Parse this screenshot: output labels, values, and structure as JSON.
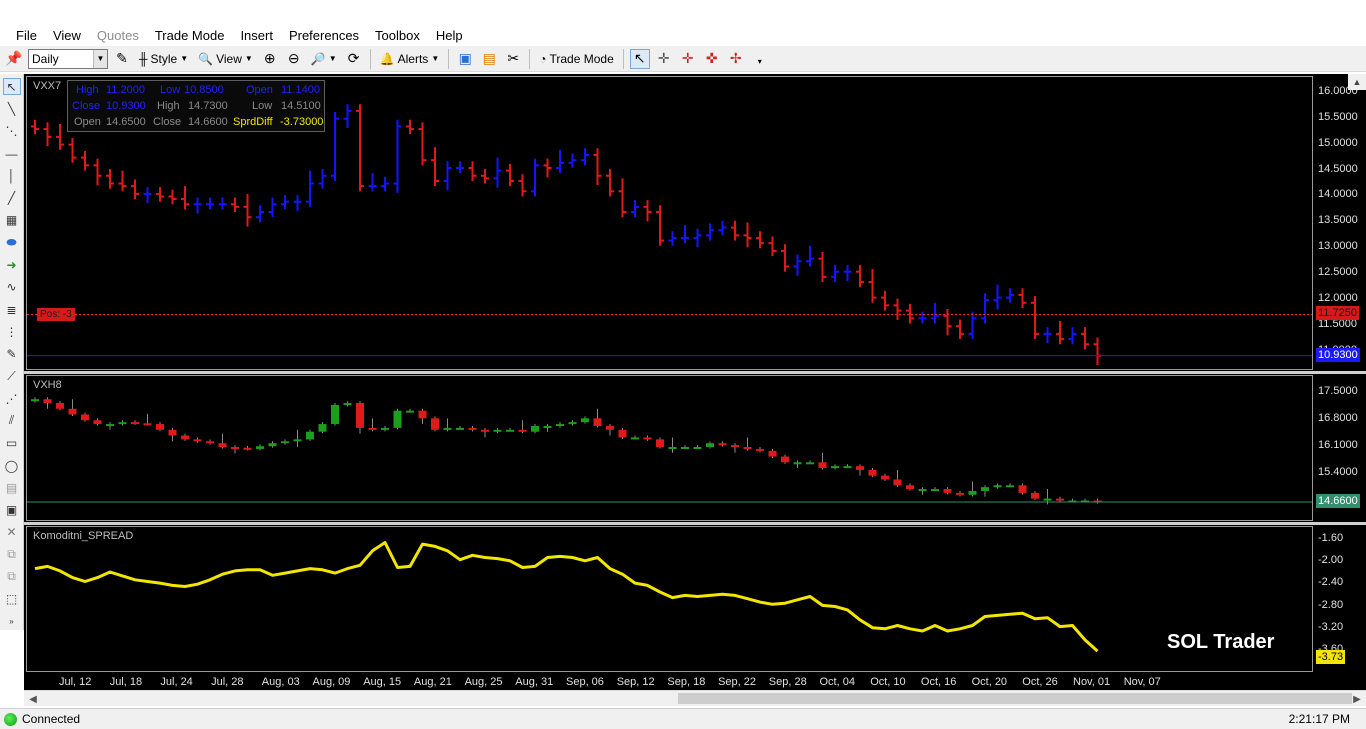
{
  "menu": [
    "File",
    "View",
    "Quotes",
    "Trade Mode",
    "Insert",
    "Preferences",
    "Toolbox",
    "Help"
  ],
  "menu_disabled": [
    "Quotes"
  ],
  "toolbar": {
    "interval": "Daily",
    "style_label": "Style",
    "view_label": "View",
    "alerts_label": "Alerts",
    "trade_mode_label": "Trade Mode"
  },
  "top_pane": {
    "symbol": "VXX7",
    "ohlc_box": {
      "row1": [
        "High",
        "11.2000",
        "Low",
        "10.8500",
        "Open",
        "11.1400"
      ],
      "row2": [
        "Close",
        "10.9300",
        "High",
        "14.7300",
        "Low",
        "14.5100"
      ],
      "row3": [
        "Open",
        "14.6500",
        "Close",
        "14.6600",
        "SprdDiff",
        "-3.73000"
      ]
    },
    "position_label": "Pos: -3",
    "axis_ticks": [
      "16.0000",
      "15.5000",
      "15.0000",
      "14.5000",
      "14.0000",
      "13.5000",
      "13.0000",
      "12.5000",
      "12.0000",
      "11.5000",
      "11.0000"
    ],
    "price_tags": [
      "11.7250",
      "10.9300"
    ],
    "colors": {
      "up": "#1414ff",
      "down": "#e01a1a",
      "stop_line": "#ff2a2a",
      "last_line": "#1a1aff"
    }
  },
  "middle_pane": {
    "symbol": "VXH8",
    "axis_ticks": [
      "17.5000",
      "16.8000",
      "16.1000",
      "15.4000"
    ],
    "price_tag": "14.6600",
    "colors": {
      "up": "#1aa01a",
      "down": "#e01a1a",
      "last_line": "#2f8f6f"
    }
  },
  "bottom_pane": {
    "title": "Komoditni_SPREAD",
    "axis_ticks": [
      "-1.60",
      "-2.00",
      "-2.40",
      "-2.80",
      "-3.20",
      "-3.60"
    ],
    "price_tag": "-3.73",
    "line_color": "#f2e600",
    "watermark": "SOL Trader"
  },
  "dates": [
    "Jul, 12",
    "Jul, 18",
    "Jul, 24",
    "Jul, 28",
    "Aug, 03",
    "Aug, 09",
    "Aug, 15",
    "Aug, 21",
    "Aug, 25",
    "Aug, 31",
    "Sep, 06",
    "Sep, 12",
    "Sep, 18",
    "Sep, 22",
    "Sep, 28",
    "Oct, 04",
    "Oct, 10",
    "Oct, 16",
    "Oct, 20",
    "Oct, 26",
    "Nov, 01",
    "Nov, 07"
  ],
  "status": {
    "connection": "Connected",
    "time": "2:21:17 PM"
  },
  "chart_data": [
    {
      "type": "ohlc",
      "name": "VXX7",
      "ylim": [
        10.9,
        16.2
      ],
      "close": [
        15.3,
        15.15,
        15.0,
        14.75,
        14.6,
        14.4,
        14.25,
        14.2,
        14.05,
        14.05,
        14.0,
        13.95,
        13.85,
        13.85,
        13.85,
        13.85,
        13.8,
        13.6,
        13.7,
        13.85,
        13.9,
        13.9,
        14.25,
        14.4,
        15.5,
        15.65,
        14.2,
        14.2,
        14.25,
        15.35,
        15.3,
        14.7,
        14.3,
        14.55,
        14.55,
        14.4,
        14.35,
        14.5,
        14.3,
        14.1,
        14.6,
        14.55,
        14.65,
        14.7,
        14.8,
        14.4,
        14.1,
        13.7,
        13.8,
        13.7,
        13.15,
        13.2,
        13.2,
        13.25,
        13.35,
        13.4,
        13.25,
        13.2,
        13.1,
        12.95,
        12.65,
        12.75,
        12.8,
        12.45,
        12.55,
        12.55,
        12.35,
        12.05,
        11.9,
        11.8,
        11.65,
        11.65,
        11.7,
        11.5,
        11.35,
        11.65,
        12.0,
        12.05,
        12.1,
        11.95,
        11.35,
        11.35,
        11.25,
        11.35,
        11.15,
        10.93
      ]
    },
    {
      "type": "candlestick",
      "name": "VXH8",
      "ylim": [
        14.4,
        17.8
      ],
      "close": [
        17.35,
        17.25,
        17.1,
        16.95,
        16.8,
        16.7,
        16.7,
        16.75,
        16.72,
        16.7,
        16.55,
        16.4,
        16.3,
        16.25,
        16.2,
        16.1,
        16.08,
        16.05,
        16.12,
        16.2,
        16.25,
        16.3,
        16.5,
        16.7,
        17.2,
        17.25,
        16.6,
        16.55,
        16.6,
        17.05,
        17.05,
        16.85,
        16.55,
        16.6,
        16.6,
        16.55,
        16.5,
        16.55,
        16.55,
        16.5,
        16.65,
        16.65,
        16.7,
        16.75,
        16.85,
        16.65,
        16.55,
        16.35,
        16.35,
        16.3,
        16.1,
        16.1,
        16.1,
        16.1,
        16.2,
        16.15,
        16.1,
        16.05,
        16.0,
        15.85,
        15.7,
        15.7,
        15.7,
        15.55,
        15.6,
        15.6,
        15.5,
        15.35,
        15.25,
        15.1,
        15.0,
        15.0,
        15.0,
        14.9,
        14.85,
        14.95,
        15.05,
        15.1,
        15.1,
        14.9,
        14.75,
        14.75,
        14.7,
        14.7,
        14.7,
        14.66
      ]
    },
    {
      "type": "line",
      "name": "Komoditni_SPREAD",
      "ylim": [
        -3.73,
        -1.6
      ],
      "values": [
        -2.12,
        -2.08,
        -2.16,
        -2.28,
        -2.35,
        -2.28,
        -2.18,
        -2.25,
        -2.32,
        -2.35,
        -2.38,
        -2.42,
        -2.44,
        -2.4,
        -2.32,
        -2.22,
        -2.16,
        -2.14,
        -2.14,
        -2.24,
        -2.2,
        -2.16,
        -2.12,
        -2.14,
        -2.2,
        -2.12,
        -2.06,
        -1.8,
        -1.65,
        -2.1,
        -2.08,
        -1.68,
        -1.72,
        -1.8,
        -1.96,
        -1.88,
        -1.92,
        -1.94,
        -1.98,
        -2.1,
        -2.08,
        -1.92,
        -1.9,
        -1.92,
        -1.98,
        -1.92,
        -2.12,
        -2.22,
        -2.38,
        -2.42,
        -2.54,
        -2.64,
        -2.6,
        -2.62,
        -2.6,
        -2.58,
        -2.6,
        -2.66,
        -2.72,
        -2.76,
        -2.74,
        -2.68,
        -2.62,
        -2.78,
        -2.8,
        -2.86,
        -3.04,
        -3.18,
        -3.2,
        -3.14,
        -3.2,
        -3.24,
        -3.14,
        -3.24,
        -3.2,
        -3.14,
        -2.98,
        -2.96,
        -2.94,
        -2.92,
        -3.02,
        -3.0,
        -3.16,
        -3.14,
        -3.4,
        -3.6
      ]
    }
  ]
}
